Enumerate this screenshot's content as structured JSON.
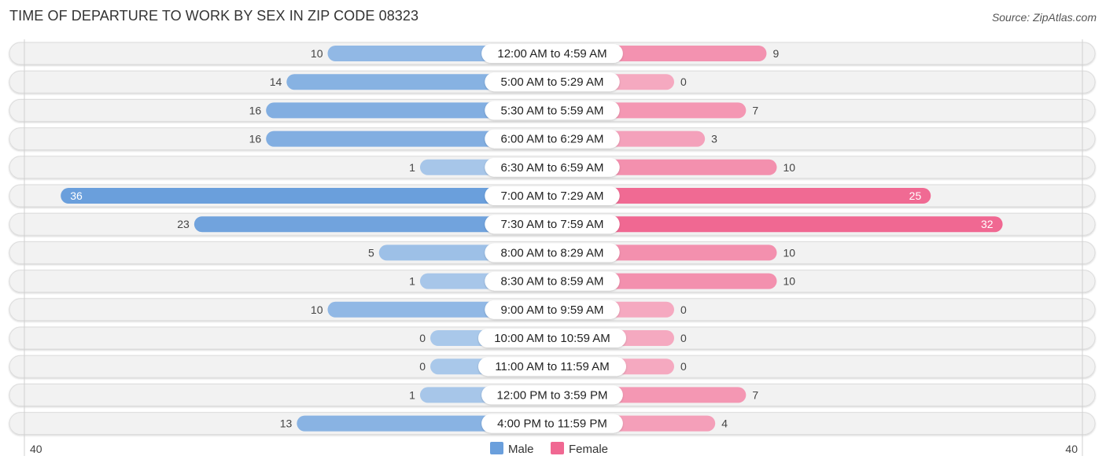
{
  "header": {
    "title": "TIME OF DEPARTURE TO WORK BY SEX IN ZIP CODE 08323",
    "source": "Source: ZipAtlas.com"
  },
  "colors": {
    "male": "#6a9fdc",
    "male_light": "#a9c8ea",
    "female": "#f06892",
    "female_light": "#f5a9c0",
    "row_bg": "#f2f2f2"
  },
  "chart_data": {
    "type": "bar",
    "orientation": "horizontal-diverging",
    "title": "TIME OF DEPARTURE TO WORK BY SEX IN ZIP CODE 08323",
    "categories": [
      "12:00 AM to 4:59 AM",
      "5:00 AM to 5:29 AM",
      "5:30 AM to 5:59 AM",
      "6:00 AM to 6:29 AM",
      "6:30 AM to 6:59 AM",
      "7:00 AM to 7:29 AM",
      "7:30 AM to 7:59 AM",
      "8:00 AM to 8:29 AM",
      "8:30 AM to 8:59 AM",
      "9:00 AM to 9:59 AM",
      "10:00 AM to 10:59 AM",
      "11:00 AM to 11:59 AM",
      "12:00 PM to 3:59 PM",
      "4:00 PM to 11:59 PM"
    ],
    "series": [
      {
        "name": "Male",
        "values": [
          10,
          14,
          16,
          16,
          1,
          36,
          23,
          5,
          1,
          10,
          0,
          0,
          1,
          13
        ]
      },
      {
        "name": "Female",
        "values": [
          9,
          0,
          7,
          3,
          10,
          25,
          32,
          10,
          10,
          0,
          0,
          0,
          7,
          4
        ]
      }
    ],
    "axis": {
      "left_tick": "40",
      "right_tick": "40",
      "range": [
        0,
        40
      ]
    },
    "legend": {
      "position": "bottom-center",
      "entries": [
        "Male",
        "Female"
      ]
    },
    "grid": false
  }
}
